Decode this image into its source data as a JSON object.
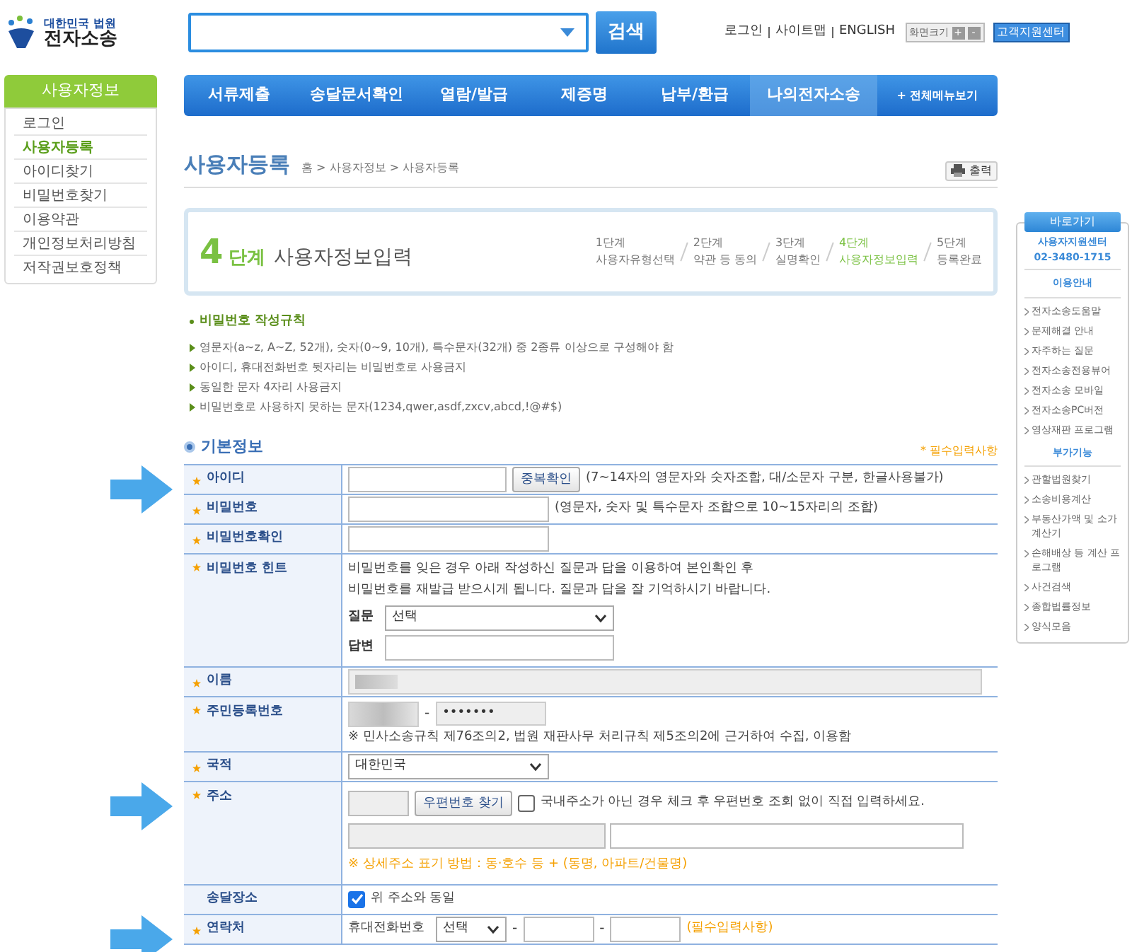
{
  "logo": {
    "line1": "대한민국 법원",
    "line2": "전자소송"
  },
  "search": {
    "button": "검색"
  },
  "top_links": [
    "로그인",
    "사이트맵",
    "ENGLISH"
  ],
  "zoom": {
    "label": "화면크기",
    "plus": "+",
    "minus": "-"
  },
  "support_button": "고객지원센터",
  "nav": [
    {
      "label": "서류제출",
      "selected": false
    },
    {
      "label": "송달문서확인",
      "selected": false
    },
    {
      "label": "열람/발급",
      "selected": false
    },
    {
      "label": "제증명",
      "selected": false
    },
    {
      "label": "납부/환급",
      "selected": false
    },
    {
      "label": "나의전자소송",
      "selected": true
    }
  ],
  "all_menu": "+ 전체메뉴보기",
  "sidebar": {
    "title": "사용자정보",
    "items": [
      {
        "label": "로그인",
        "selected": false
      },
      {
        "label": "사용자등록",
        "selected": true
      },
      {
        "label": "아이디찾기",
        "selected": false
      },
      {
        "label": "비밀번호찾기",
        "selected": false
      },
      {
        "label": "이용약관",
        "selected": false
      },
      {
        "label": "개인정보처리방침",
        "selected": false
      },
      {
        "label": "저작권보호정책",
        "selected": false
      }
    ]
  },
  "page": {
    "title": "사용자등록",
    "breadcrumb": "홈 > 사용자정보 > 사용자등록",
    "print": "출력"
  },
  "stepbox": {
    "number": "4",
    "unit": "단계",
    "title": "사용자정보입력",
    "steps": [
      {
        "num": "1단계",
        "label": "사용자유형선택",
        "selected": false
      },
      {
        "num": "2단계",
        "label": "약관 등 동의",
        "selected": false
      },
      {
        "num": "3단계",
        "label": "실명확인",
        "selected": false
      },
      {
        "num": "4단계",
        "label": "사용자정보입력",
        "selected": true
      },
      {
        "num": "5단계",
        "label": "등록완료",
        "selected": false
      }
    ]
  },
  "rules": {
    "title": "비밀번호 작성규칙",
    "items": [
      "영문자(a~z, A~Z, 52개), 숫자(0~9, 10개), 특수문자(32개) 중 2종류 이상으로 구성해야 함",
      "아이디, 휴대전화번호 뒷자리는 비밀번호로 사용금지",
      "동일한 문자 4자리 사용금지",
      "비밀번호로 사용하지 못하는 문자(1234,qwer,asdf,zxcv,abcd,!@#$)"
    ]
  },
  "section": {
    "title": "기본정보",
    "required_note": "* 필수입력사항"
  },
  "rows": [
    {
      "kind": "id",
      "label": "아이디",
      "required": true,
      "arrow": true,
      "button": "중복확인",
      "hint": "(7~14자의 영문자와 숫자조합, 대/소문자 구분, 한글사용불가)"
    },
    {
      "kind": "password",
      "label": "비밀번호",
      "required": true,
      "arrow": false,
      "hint": "(영문자, 숫자 및 특수문자 조합으로 10~15자리의 조합)"
    },
    {
      "kind": "password",
      "label": "비밀번호확인",
      "required": true,
      "arrow": false
    },
    {
      "kind": "hint",
      "label": "비밀번호 힌트",
      "required": true,
      "arrow": false,
      "lines": [
        "비밀번호를 잊은 경우 아래 작성하신 질문과 답을 이용하여 본인확인 후",
        "비밀번호를 재발급 받으시게 됩니다. 질문과 답을 잘 기억하시기 바랍니다."
      ],
      "question_label": "질문",
      "question_value": "선택",
      "answer_label": "답변"
    },
    {
      "kind": "name",
      "label": "이름",
      "required": true,
      "arrow": false
    },
    {
      "kind": "ssn",
      "label": "주민등록번호",
      "required": true,
      "arrow": false,
      "dash": "-",
      "masked": "•••••••",
      "note": "※ 민사소송규칙 제76조의2, 법원 재판사무 처리규칙 제5조의2에 근거하여 수집, 이용함"
    },
    {
      "kind": "select",
      "label": "국적",
      "required": true,
      "arrow": false,
      "value": "대한민국"
    },
    {
      "kind": "address",
      "label": "주소",
      "required": true,
      "arrow": true,
      "button": "우편번호 찾기",
      "checked": false,
      "check_label": "국내주소가 아닌 경우 체크 후 우편번호 조회 없이 직접 입력하세요.",
      "note": "※ 상세주소 표기 방법 : 동·호수 등 + (동명, 아파트/건물명)"
    },
    {
      "kind": "check",
      "label": "송달장소",
      "required": false,
      "arrow": false,
      "checked": true,
      "check_label": "위 주소와 동일"
    },
    {
      "kind": "phone",
      "label": "연락처",
      "required": true,
      "arrow": true,
      "sub_label": "휴대전화번호",
      "value": "선택",
      "dash": "-",
      "note": "(필수입력사항)"
    }
  ],
  "quick": {
    "title": "바로가기",
    "center": "사용자지원센터",
    "phone": "02-3480-1715",
    "sections": [
      {
        "title": "이용안내",
        "items": [
          "전자소송도움말",
          "문제해결 안내",
          "자주하는 질문",
          "전자소송전용뷰어",
          "전자소송 모바일",
          "전자소송PC버전",
          "영상재판 프로그램"
        ]
      },
      {
        "title": "부가기능",
        "items": [
          "관할법원찾기",
          "소송비용계산",
          "부동산가액 및 소가계산기",
          "손해배상 등 계산 프로그램",
          "사건검색",
          "종합법률정보",
          "양식모음"
        ]
      }
    ]
  }
}
